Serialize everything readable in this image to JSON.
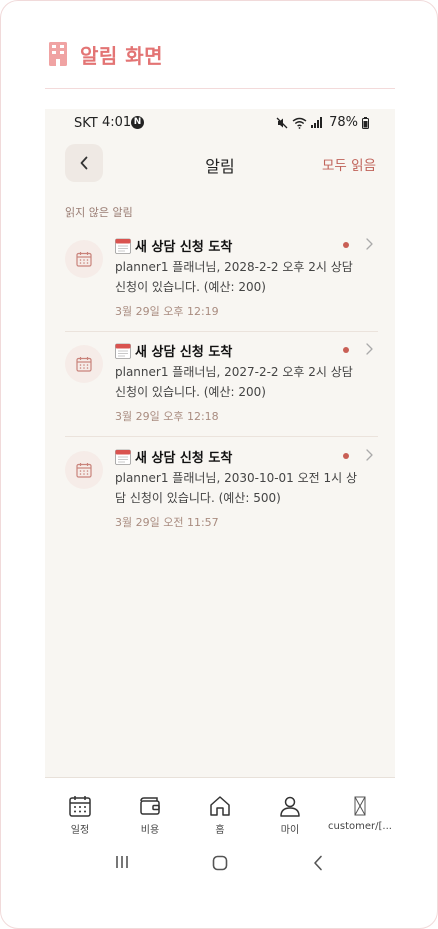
{
  "header": {
    "title": "알림 화면"
  },
  "status_bar": {
    "carrier": "SKT",
    "time": "4:01",
    "account_badge": "N",
    "battery": "78%"
  },
  "app_bar": {
    "title": "알림",
    "mark_all_read": "모두 읽음"
  },
  "section": {
    "unread_label": "읽지 않은 알림"
  },
  "notifications": [
    {
      "title": "새 상담 신청 도착",
      "body": "planner1 플래너님, 2028-2-2 오후 2시 상담 신청이 있습니다. (예산: 200)",
      "timestamp": "3월 29일 오후 12:19",
      "unread": true
    },
    {
      "title": "새 상담 신청 도착",
      "body": "planner1 플래너님, 2027-2-2 오후 2시 상담 신청이 있습니다. (예산: 200)",
      "timestamp": "3월 29일 오후 12:18",
      "unread": true
    },
    {
      "title": "새 상담 신청 도착",
      "body": "planner1 플래너님, 2030-10-01 오전 1시 상담 신청이 있습니다. (예산: 500)",
      "timestamp": "3월 29일 오전 11:57",
      "unread": true
    }
  ],
  "tabs": [
    {
      "label": "일정",
      "icon": "calendar-icon"
    },
    {
      "label": "비용",
      "icon": "wallet-icon"
    },
    {
      "label": "홈",
      "icon": "home-icon"
    },
    {
      "label": "마이",
      "icon": "person-icon"
    },
    {
      "label": "customer/[...",
      "icon": "placeholder-icon"
    }
  ],
  "colors": {
    "accent": "#e37474",
    "link": "#c0635a",
    "unread_dot": "#c95f55",
    "background": "#f8f6f2"
  }
}
